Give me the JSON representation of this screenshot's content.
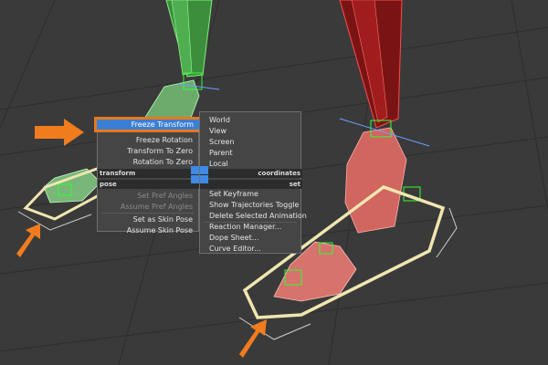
{
  "quad_left": {
    "highlighted": "Freeze Transform",
    "transform_items": [
      "Freeze Rotation",
      "Transform To Zero",
      "Rotation To Zero"
    ],
    "pose_items_disabled": [
      "Set Pref Angles",
      "Assume Pref Angles"
    ],
    "pose_items": [
      "Set as Skin Pose",
      "Assume Skin Pose"
    ],
    "transform_header": "transform",
    "pose_header": "pose"
  },
  "quad_right": {
    "coordinate_items": [
      "World",
      "View",
      "Screen",
      "Parent",
      "Local"
    ],
    "coordinates_header": "coordinates",
    "set_header": "set",
    "set_items": [
      "Set Keyframe",
      "Show Trajectories Toggle",
      "Delete Selected Animation",
      "Reaction Manager...",
      "Dope Sheet...",
      "Curve Editor..."
    ]
  },
  "colors": {
    "menu_bg": "#454545",
    "highlight": "#3a7fd6",
    "callout_arrow": "#f07c1e",
    "green_rig": "#5fd35f",
    "red_rig": "#e05a55"
  }
}
